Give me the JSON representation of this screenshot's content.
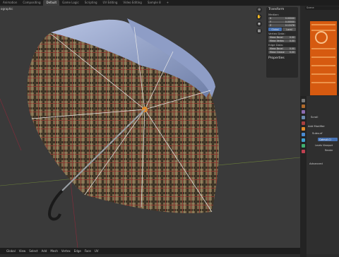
{
  "workspace_tabs": [
    "Animation",
    "Compositing",
    "Default",
    "Game Logic",
    "Scripting",
    "UV Editing",
    "Video Editing",
    "Sample 8",
    "+"
  ],
  "active_tab_index": 2,
  "scene": "Scene",
  "viewport": {
    "view_label": "ographic",
    "npanel": {
      "header": "Transform",
      "median_label": "Median:",
      "axes": [
        {
          "axis": "X",
          "value": "0.00000"
        },
        {
          "axis": "Y",
          "value": "0.00000"
        },
        {
          "axis": "Z",
          "value": "0.12476"
        }
      ],
      "global_btn": "Global",
      "local_btn": "Local",
      "vertex_data_label": "Vertex Data:",
      "mean_bevel_weight": "Mean Bevel",
      "mean_vertex": "Mean Vertex",
      "edge_data_label": "Edge Data:",
      "mean_bevel_edge": "Mean Bevel",
      "mean_crease": "Mean Crease",
      "values": [
        "0.00",
        "0.00",
        "0.00",
        "0.00"
      ],
      "properties_label": "Properties"
    },
    "side_tabs": [
      "Item",
      "Tool",
      "View"
    ]
  },
  "bottom_bar": [
    "View",
    "Select",
    "Add",
    "Mesh",
    "Vertex",
    "Edge",
    "Face",
    "UV"
  ],
  "orientation": "Global",
  "properties": {
    "object_name": "Scroll",
    "add_modifier": "Add Modifier",
    "modifier_name": "Subsurf",
    "mod_btn": "Catmull-Cl",
    "levels_label": "Levels Viewport",
    "render_label": "Render",
    "advanced_label": "Advanced"
  }
}
